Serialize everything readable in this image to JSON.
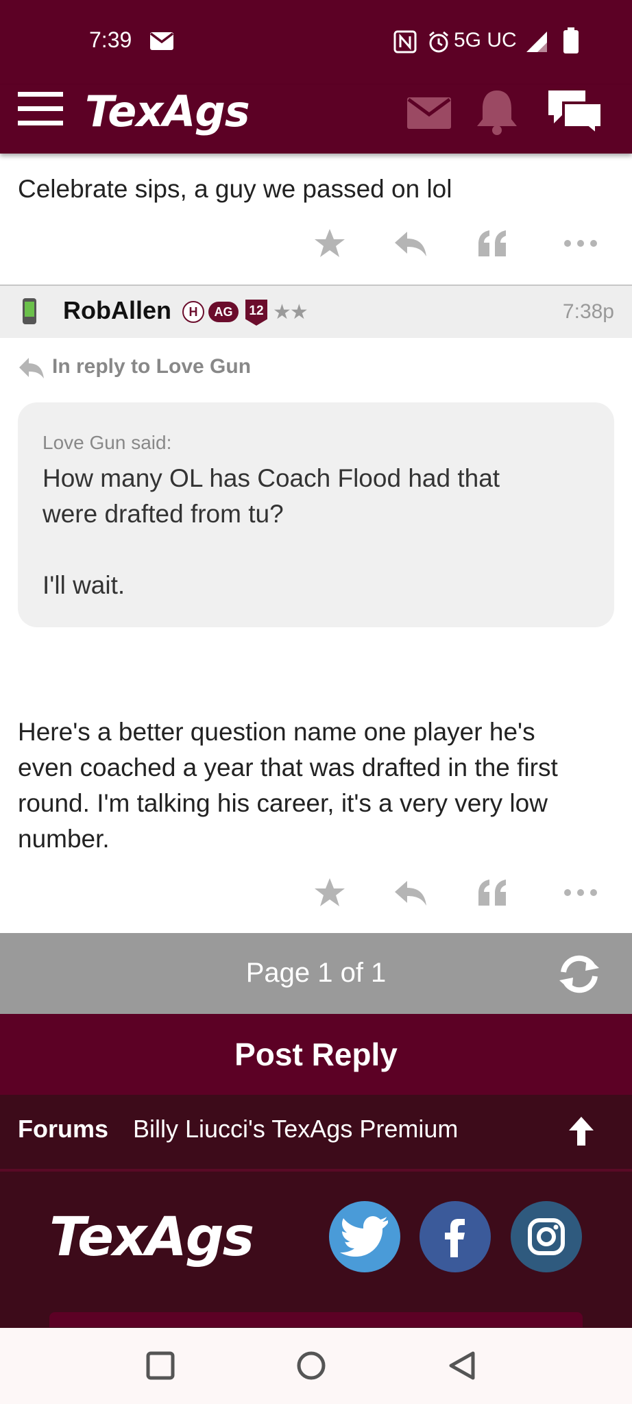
{
  "status_bar": {
    "time": "7:39",
    "network": "5G UC"
  },
  "app": {
    "logo": "TexAgs"
  },
  "previous_post": {
    "text": "Celebrate sips, a guy we passed on lol"
  },
  "post": {
    "username": "RobAllen",
    "badges": [
      "H",
      "AG",
      "12"
    ],
    "stars": "★★",
    "time": "7:38p",
    "reply_to": "In reply to Love Gun",
    "quote": {
      "author": "Love Gun said:",
      "lines": [
        "How many OL has Coach Flood had that",
        "were drafted from tu?",
        "",
        "I'll wait."
      ]
    },
    "body_lines": [
      "Here's a better question name one player he's",
      "even coached a year that was drafted in the first",
      "round. I'm talking his career, it's a very very low",
      "number."
    ]
  },
  "pager": {
    "label": "Page 1 of 1"
  },
  "post_reply_label": "Post Reply",
  "breadcrumb": {
    "forums": "Forums",
    "board": "Billy Liucci's TexAgs Premium"
  },
  "footer": {
    "logo": "TexAgs",
    "social": [
      "twitter-icon",
      "facebook-icon",
      "instagram-icon"
    ]
  },
  "colors": {
    "maroon": "#5c0125",
    "dark_maroon": "#3d0b1a",
    "pager_gray": "#9a9a9a"
  }
}
